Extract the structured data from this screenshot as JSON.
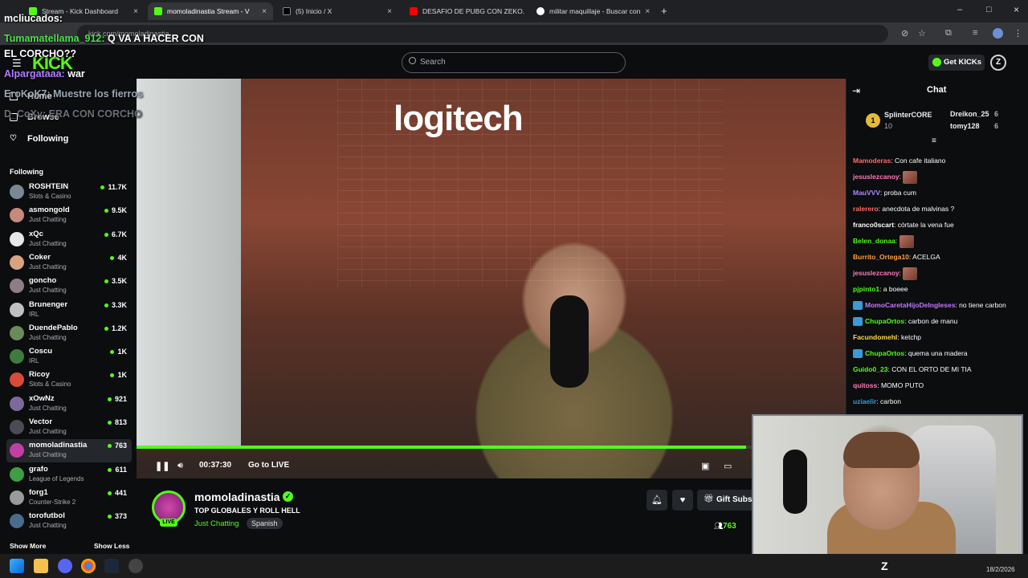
{
  "browser": {
    "tabs": [
      {
        "label": "Stream - Kick Dashboard",
        "close": "×"
      },
      {
        "label": "momoladinastia Stream - V",
        "close": "×"
      },
      {
        "label": "(5) Inicio / X",
        "close": "×"
      },
      {
        "label": "DESAFIO DE PUBG CON ZEKO.",
        "close": "×"
      },
      {
        "label": "militar maquillaje - Buscar con",
        "close": "×"
      }
    ],
    "new_tab": "+",
    "url": "kick.com/momoladinastia",
    "window_controls": [
      "–",
      "□",
      "×"
    ]
  },
  "overlay_chat": [
    {
      "user": "mcliucados:",
      "text": "",
      "color": "#ffffff"
    },
    {
      "user": "Tumamatellama_912:",
      "text": "Q VA A HACER CON",
      "color": "#4fe04f"
    },
    {
      "user": "",
      "text": "EL CORCHO??",
      "color": "#ffffff"
    },
    {
      "user": "Alpargataaa:",
      "text": "war",
      "color": "#b07dff"
    },
    {
      "user": "EroKoK7:",
      "text": "Muestre los fierros",
      "color": "#9aa7b3"
    },
    {
      "user": "D_CoXy:",
      "text": "ERA CON CORCHO",
      "color": "#6b7077"
    }
  ],
  "header": {
    "logo": "KICK",
    "search_placeholder": "Search",
    "get_kicks": "Get KICKs",
    "avatar_letter": "Z"
  },
  "sidebar": {
    "nav": [
      {
        "label": "Home",
        "icon": "home-icon"
      },
      {
        "label": "Browse",
        "icon": "browse-icon"
      },
      {
        "label": "Following",
        "icon": "heart-icon"
      }
    ],
    "following_heading": "Following",
    "channels": [
      {
        "name": "ROSHTEIN",
        "category": "Slots & Casino",
        "viewers": "11.7K",
        "color": "#7b8794"
      },
      {
        "name": "asmongold",
        "category": "Just Chatting",
        "viewers": "9.5K",
        "color": "#c7897a"
      },
      {
        "name": "xQc",
        "category": "Just Chatting",
        "viewers": "6.7K",
        "color": "#e8e8e8"
      },
      {
        "name": "Coker",
        "category": "Just Chatting",
        "viewers": "4K",
        "color": "#d9a37f"
      },
      {
        "name": "goncho",
        "category": "Just Chatting",
        "viewers": "3.5K",
        "color": "#8c7d88"
      },
      {
        "name": "Brunenger",
        "category": "IRL",
        "viewers": "3.3K",
        "color": "#c0c0c0"
      },
      {
        "name": "DuendePablo",
        "category": "Just Chatting",
        "viewers": "1.2K",
        "color": "#6b8a5a"
      },
      {
        "name": "Coscu",
        "category": "IRL",
        "viewers": "1K",
        "color": "#3f7a3f"
      },
      {
        "name": "Ricoy",
        "category": "Slots & Casino",
        "viewers": "1K",
        "color": "#d94a3a"
      },
      {
        "name": "xOwNz",
        "category": "Just Chatting",
        "viewers": "921",
        "color": "#7c6a9a"
      },
      {
        "name": "Vector",
        "category": "Just Chatting",
        "viewers": "813",
        "color": "#4b4b55"
      },
      {
        "name": "momoladinastia",
        "category": "Just Chatting",
        "viewers": "763",
        "color": "#c13fa3"
      },
      {
        "name": "grafo",
        "category": "League of Legends",
        "viewers": "611",
        "color": "#3e9e45"
      },
      {
        "name": "forg1",
        "category": "Counter-Strike 2",
        "viewers": "441",
        "color": "#9a9a9a"
      },
      {
        "name": "torofutbol",
        "category": "Just Chatting",
        "viewers": "373",
        "color": "#4a6c8c"
      }
    ],
    "show_more": "Show More",
    "show_less": "Show Less"
  },
  "player": {
    "progress": 0.86,
    "time": "00:37:30",
    "go_live": "Go to LIVE",
    "scene_sign": "logitech"
  },
  "stream_info": {
    "channel": "momoladinastia",
    "live": "LIVE",
    "title": "TOP GLOBALES Y ROLL HELL",
    "category": "Just Chatting",
    "language": "Spanish",
    "gift_subs": "Gift Subs",
    "viewers": "763"
  },
  "chat": {
    "title": "Chat",
    "leaderboard": [
      {
        "rank": "1",
        "name": "SplinterCORE",
        "count": "10",
        "color": "#e6b93a"
      },
      {
        "name": "Dreikon_25",
        "count": "6",
        "color": "#ffffff"
      },
      {
        "name": "tomy128",
        "count": "6",
        "color": "#ff9e3d"
      }
    ],
    "messages": [
      {
        "user": "Mamoderas",
        "text": ": Con cafe italiano",
        "color": "#ff6b6b",
        "emote": false,
        "badge": false,
        "two": false
      },
      {
        "user": "jesuslezcanoy",
        "text": ": ",
        "color": "#ff7ab7",
        "emote": true,
        "badge": false,
        "two": false
      },
      {
        "user": "MauVVV",
        "text": ": proba cum",
        "color": "#a98bff",
        "emote": false,
        "badge": false,
        "two": false
      },
      {
        "user": "ralerero",
        "text": ": anecdota de malvinas ?",
        "color": "#ff6b6b",
        "emote": false,
        "badge": false,
        "two": false
      },
      {
        "user": "franco0scart",
        "text": ": córtate la vena fue",
        "color": "#ffffff",
        "emote": false,
        "badge": false,
        "two": false
      },
      {
        "user": "Belen_donaa",
        "text": ": ",
        "color": "#53fc18",
        "emote": true,
        "badge": false,
        "two": false
      },
      {
        "user": "Burrito_Ortega10",
        "text": ": ACELGA",
        "color": "#ff9e3d",
        "emote": false,
        "badge": false,
        "two": false
      },
      {
        "user": "jesuslezcanoy",
        "text": ": ",
        "color": "#ff7ab7",
        "emote": true,
        "badge": false,
        "two": false
      },
      {
        "user": "pjpinto1",
        "text": ": a boeee",
        "color": "#53fc18",
        "emote": false,
        "badge": false,
        "two": false
      },
      {
        "user": "MomoCaretaHijoDeIngleses",
        "text": ": no tiene carbon",
        "color": "#c178ff",
        "emote": false,
        "badge": true,
        "two": true
      },
      {
        "user": "ChupaOrtos",
        "text": ": carbon de manu",
        "color": "#53fc18",
        "emote": false,
        "badge": true,
        "two": false
      },
      {
        "user": "Facundomehl",
        "text": ": ketchp",
        "color": "#ffd84a",
        "emote": false,
        "badge": false,
        "two": false
      },
      {
        "user": "ChupaOrtos",
        "text": ": quema una madera",
        "color": "#53fc18",
        "emote": false,
        "badge": true,
        "two": false
      },
      {
        "user": "Guido0_23",
        "text": ": CON EL ORTO DE MI TIA",
        "color": "#53fc18",
        "emote": false,
        "badge": false,
        "two": false
      },
      {
        "user": "quitoss",
        "text": ": MOMO PUTO",
        "color": "#ff7ab7",
        "emote": false,
        "badge": false,
        "two": false
      },
      {
        "user": "uziaelir",
        "text": ": carbon",
        "color": "#3a9bd8",
        "emote": false,
        "badge": false,
        "two": false
      }
    ]
  },
  "taskbar": {
    "date": "18/2/2026"
  }
}
